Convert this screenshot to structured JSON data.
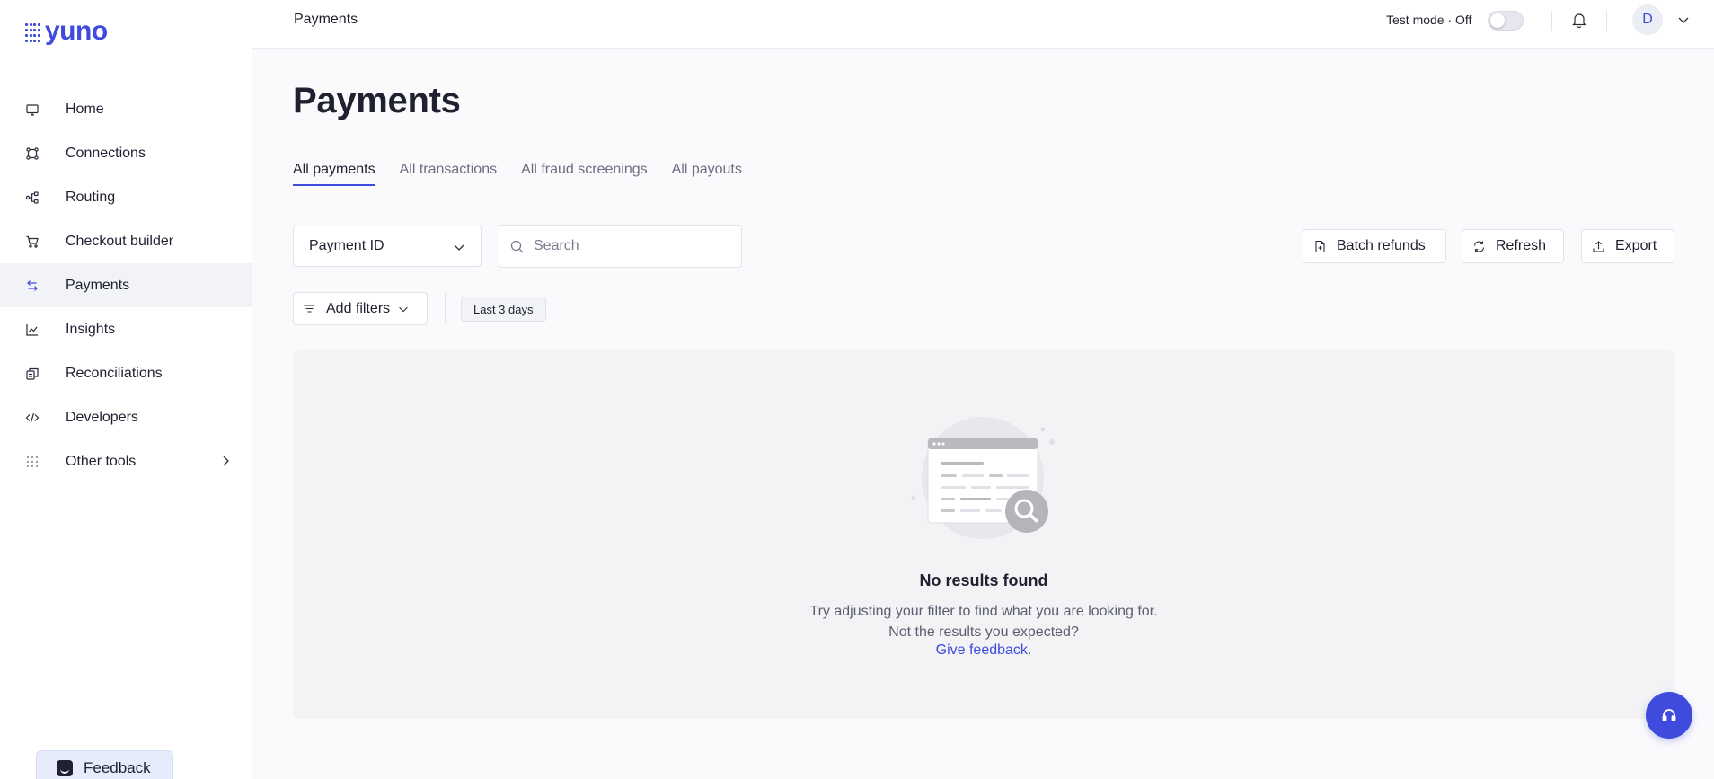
{
  "brand": {
    "logo_text": "yuno",
    "accent": "#3e4bdc"
  },
  "sidebar": {
    "items": [
      {
        "label": "Home",
        "icon": "monitor-icon"
      },
      {
        "label": "Connections",
        "icon": "connections-icon"
      },
      {
        "label": "Routing",
        "icon": "routing-icon"
      },
      {
        "label": "Checkout builder",
        "icon": "cart-icon"
      },
      {
        "label": "Payments",
        "icon": "transfer-arrows-icon",
        "active": true
      },
      {
        "label": "Insights",
        "icon": "line-chart-icon"
      },
      {
        "label": "Reconciliations",
        "icon": "reconciliation-icon"
      },
      {
        "label": "Developers",
        "icon": "code-icon"
      },
      {
        "label": "Other tools",
        "icon": "grid-dots-icon"
      }
    ],
    "feedback_label": "Feedback"
  },
  "header": {
    "breadcrumb": "Payments",
    "test_mode_label": "Test mode · Off",
    "avatar_initial": "D"
  },
  "main": {
    "title": "Payments",
    "tabs": [
      {
        "label": "All payments",
        "active": true
      },
      {
        "label": "All transactions"
      },
      {
        "label": "All fraud screenings"
      },
      {
        "label": "All payouts"
      }
    ],
    "search_field_select": "Payment ID",
    "search_placeholder": "Search",
    "actions": {
      "batch_refunds": "Batch refunds",
      "refresh": "Refresh",
      "export": "Export"
    },
    "add_filters_label": "Add filters",
    "date_chip": "Last 3 days",
    "empty_state": {
      "title": "No results found",
      "message": "Try adjusting your filter to find what you are looking for. Not the results you expected?",
      "link_text": "Give feedback",
      "link_suffix": "."
    }
  }
}
